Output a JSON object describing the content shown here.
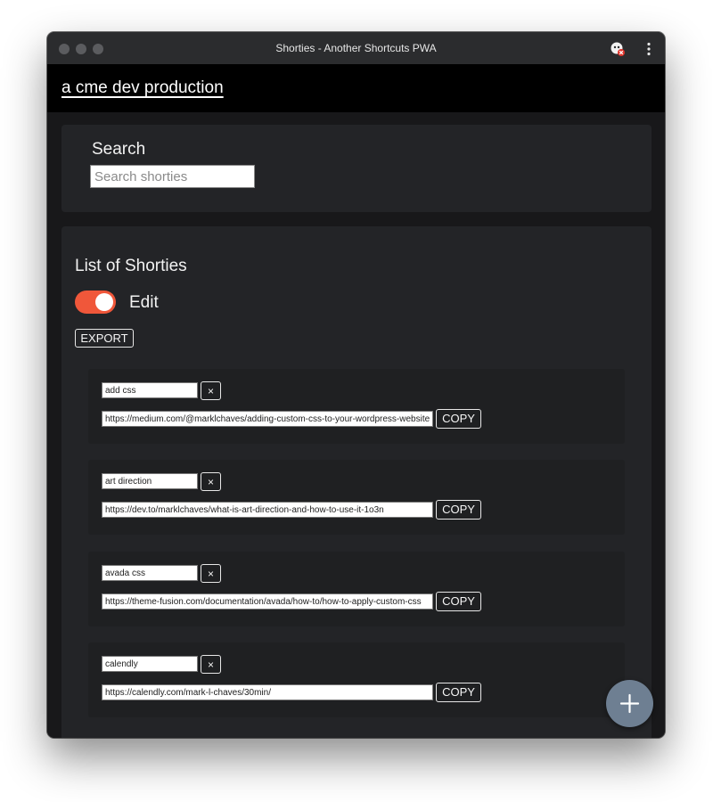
{
  "window": {
    "title": "Shorties - Another Shortcuts PWA"
  },
  "icons": {
    "extension": "extension-blocked-icon",
    "menu": "more-vert-icon",
    "add": "plus-icon",
    "remove": "close-icon"
  },
  "colors": {
    "accent": "#f0573a",
    "fab": "#6e7f92",
    "header_bg": "#000000",
    "card_bg": "#232427",
    "page_bg": "#18181a"
  },
  "header": {
    "brand": "a cme dev production"
  },
  "search": {
    "title": "Search",
    "placeholder": "Search shorties",
    "value": ""
  },
  "list": {
    "title": "List of Shorties",
    "edit_label": "Edit",
    "edit_enabled": true,
    "export_label": "EXPORT",
    "items": [
      {
        "name": "add css",
        "url": "https://medium.com/@marklchaves/adding-custom-css-to-your-wordpress-website",
        "remove_label": "×",
        "copy_label": "COPY"
      },
      {
        "name": "art direction",
        "url": "https://dev.to/marklchaves/what-is-art-direction-and-how-to-use-it-1o3n",
        "remove_label": "×",
        "copy_label": "COPY"
      },
      {
        "name": "avada css",
        "url": "https://theme-fusion.com/documentation/avada/how-to/how-to-apply-custom-css",
        "remove_label": "×",
        "copy_label": "COPY"
      },
      {
        "name": "calendly",
        "url": "https://calendly.com/mark-l-chaves/30min/",
        "remove_label": "×",
        "copy_label": "COPY"
      }
    ]
  }
}
